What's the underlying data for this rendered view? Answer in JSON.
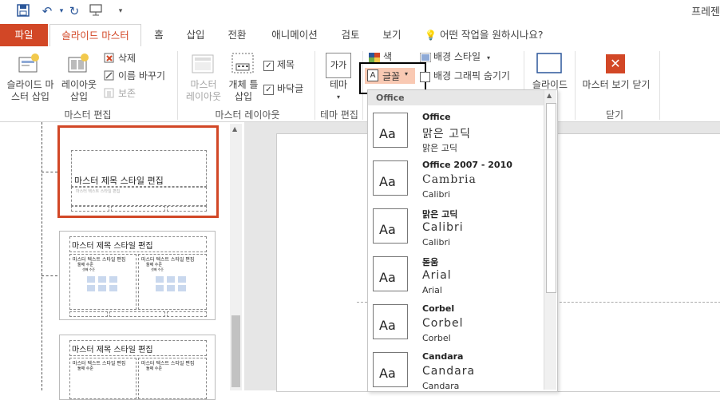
{
  "app_title": "프레젠",
  "tabs": [
    "파일",
    "슬라이드 마스터",
    "홈",
    "삽입",
    "전환",
    "애니메이션",
    "검토",
    "보기"
  ],
  "tell_me": "어떤 작업을 원하시나요?",
  "ribbon": {
    "edit_master": {
      "insert_master": [
        "슬라이드 마",
        "스터 삽입"
      ],
      "insert_layout": [
        "레이아웃",
        "삽입"
      ],
      "delete": "삭제",
      "rename": "이름 바꾸기",
      "preserve": "보존",
      "group": "마스터 편집"
    },
    "master_layout": {
      "master_layout": [
        "마스터",
        "레이아웃"
      ],
      "insert_placeholder": [
        "개체 틀",
        "삽입"
      ],
      "title": "제목",
      "footer": "바닥글",
      "group": "마스터 레이아웃"
    },
    "edit_theme": {
      "theme_icon": "가가",
      "theme": "테마",
      "group": "테마 편집"
    },
    "background": {
      "colors": "색",
      "fonts": "글꼴",
      "bg_style": "배경 스타일",
      "hide_bg": "배경 그래픽 숨기기"
    },
    "size": {
      "slide_size": "슬라이드"
    },
    "close": {
      "close_master": "마스터 보기 닫기",
      "group": "닫기"
    }
  },
  "thumbnails": [
    {
      "title": "마스터 제목 스타일 편집",
      "sub": "마스터 텍스트 스타일 편집"
    },
    {
      "title": "마스터 제목 스타일 편집",
      "body": [
        "마스터 텍스트 스타일 편집",
        "둘째 수준",
        "셋째 수준"
      ]
    },
    {
      "title": "마스터 제목 스타일 편집",
      "body": [
        "마스터 텍스트 스타일 편집",
        "둘째 수준"
      ]
    }
  ],
  "font_menu": {
    "header": "Office",
    "thumb_label": "Aa",
    "items": [
      {
        "name": "Office",
        "heading": "맑은 고딕",
        "body": "맑은 고딕"
      },
      {
        "name": "Office 2007 - 2010",
        "heading": "Cambria",
        "body": "Calibri"
      },
      {
        "name": "맑은 고딕",
        "heading": "Calibri",
        "body": "Calibri"
      },
      {
        "name": "돋움",
        "heading": "Arial",
        "body": "Arial"
      },
      {
        "name": "Corbel",
        "heading": "Corbel",
        "body": "Corbel"
      },
      {
        "name": "Candara",
        "heading": "Candara",
        "body": "Candara"
      }
    ]
  },
  "colors": {
    "accent": "#d24726",
    "ribbon_bg": "#ffffff",
    "editor_bg": "#e6e6e6"
  }
}
